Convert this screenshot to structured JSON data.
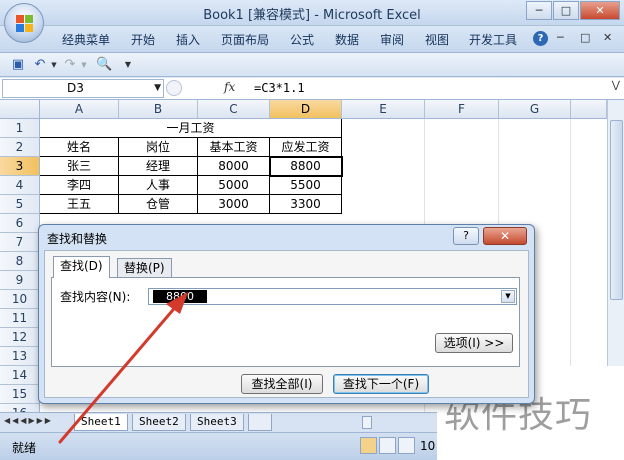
{
  "window": {
    "title": "Book1  [兼容模式] - Microsoft Excel",
    "controls": [
      "─",
      "□",
      "✕"
    ]
  },
  "ribbon_tabs": [
    "经典菜单",
    "开始",
    "插入",
    "页面布局",
    "公式",
    "数据",
    "审阅",
    "视图",
    "开发工具"
  ],
  "ribbon_right": {
    "help": "?",
    "min": "─",
    "restore": "□",
    "close": "✕"
  },
  "qat": {
    "icons": [
      "save-icon",
      "undo-icon",
      "redo-icon",
      "print-preview-icon",
      "customize-icon"
    ]
  },
  "formula_bar": {
    "name_box": "D3",
    "fx": "fx",
    "formula": "=C3*1.1"
  },
  "columns": [
    "A",
    "B",
    "C",
    "D",
    "E",
    "F",
    "G"
  ],
  "rows": [
    "1",
    "2",
    "3",
    "4",
    "5",
    "6",
    "7",
    "8",
    "9",
    "10",
    "11",
    "12",
    "13",
    "14",
    "15",
    "16"
  ],
  "table": {
    "title": "一月工资",
    "headers": [
      "姓名",
      "岗位",
      "基本工资",
      "应发工资"
    ],
    "rows": [
      [
        "张三",
        "经理",
        "8000",
        "8800"
      ],
      [
        "李四",
        "人事",
        "5000",
        "5500"
      ],
      [
        "王五",
        "仓管",
        "3000",
        "3300"
      ]
    ]
  },
  "sheets": [
    "Sheet1",
    "Sheet2",
    "Sheet3"
  ],
  "status": {
    "ready": "就绪",
    "zoom": "10"
  },
  "dialog": {
    "title": "查找和替换",
    "help": "?",
    "close": "✕",
    "tabs": [
      "查找(D)",
      "替换(P)"
    ],
    "find_label": "查找内容(N):",
    "find_value": "8800",
    "options_button": "选项(I) >>",
    "find_all_button": "查找全部(I)",
    "find_next_button": "查找下一个(F)"
  },
  "watermark": "软件技巧",
  "colors": {
    "accent": "#d33a2c",
    "selection": "#f1c15f",
    "title_text": "#1e395b"
  }
}
